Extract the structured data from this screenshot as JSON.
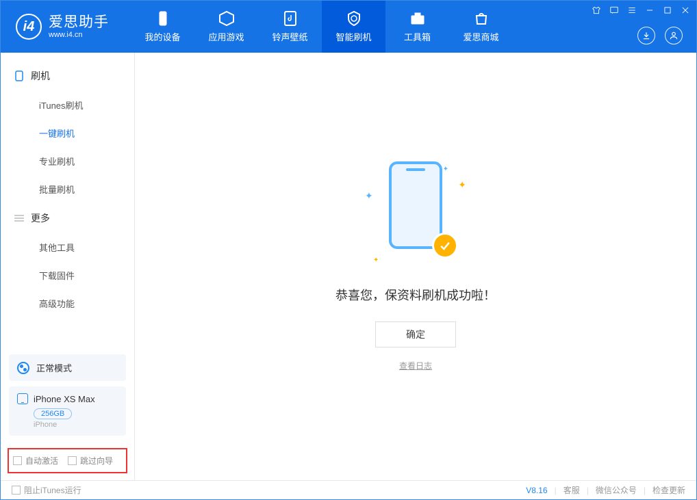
{
  "app": {
    "name": "爱思助手",
    "url": "www.i4.cn"
  },
  "nav": {
    "items": [
      {
        "label": "我的设备"
      },
      {
        "label": "应用游戏"
      },
      {
        "label": "铃声壁纸"
      },
      {
        "label": "智能刷机"
      },
      {
        "label": "工具箱"
      },
      {
        "label": "爱思商城"
      }
    ],
    "active_index": 3
  },
  "sidebar": {
    "section1": {
      "title": "刷机",
      "items": [
        {
          "label": "iTunes刷机"
        },
        {
          "label": "一键刷机"
        },
        {
          "label": "专业刷机"
        },
        {
          "label": "批量刷机"
        }
      ],
      "active_index": 1
    },
    "section2": {
      "title": "更多",
      "items": [
        {
          "label": "其他工具"
        },
        {
          "label": "下载固件"
        },
        {
          "label": "高级功能"
        }
      ]
    },
    "mode_label": "正常模式",
    "device": {
      "name": "iPhone XS Max",
      "storage": "256GB",
      "type": "iPhone"
    },
    "options": {
      "auto_activate": "自动激活",
      "skip_guide": "跳过向导"
    }
  },
  "main": {
    "success_message": "恭喜您，保资料刷机成功啦！",
    "confirm_button": "确定",
    "view_log": "查看日志"
  },
  "footer": {
    "block_itunes": "阻止iTunes运行",
    "version": "V8.16",
    "links": {
      "support": "客服",
      "wechat": "微信公众号",
      "update": "检查更新"
    }
  }
}
